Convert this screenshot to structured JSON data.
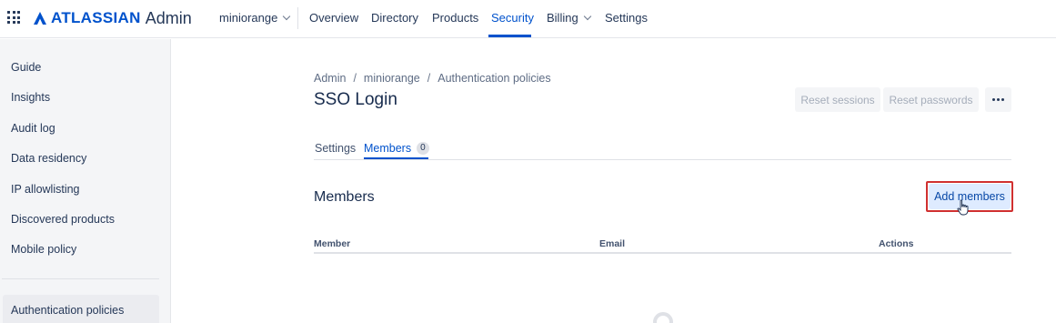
{
  "brand": {
    "name": "ATLASSIAN",
    "product": "Admin",
    "logo_icon": "atlassian-logo-icon",
    "accent": "#0052CC"
  },
  "org_selector": {
    "label": "miniorange",
    "icon": "chevron-down-icon"
  },
  "nav": {
    "items": [
      {
        "label": "Overview"
      },
      {
        "label": "Directory"
      },
      {
        "label": "Products"
      },
      {
        "label": "Security",
        "active": true
      },
      {
        "label": "Billing",
        "has_dropdown": true
      },
      {
        "label": "Settings"
      }
    ]
  },
  "sidebar": {
    "items": [
      {
        "label": "Guide"
      },
      {
        "label": "Insights"
      },
      {
        "label": "Audit log"
      },
      {
        "label": "Data residency"
      },
      {
        "label": "IP allowlisting"
      },
      {
        "label": "Discovered products"
      },
      {
        "label": "Mobile policy"
      },
      {
        "label": "Authentication policies",
        "active": true
      }
    ]
  },
  "breadcrumb": [
    "Admin",
    "miniorange",
    "Authentication policies"
  ],
  "page": {
    "title": "SSO Login"
  },
  "actions": {
    "reset_sessions": "Reset sessions",
    "reset_passwords": "Reset passwords",
    "more_icon": "more-icon"
  },
  "tabs": [
    {
      "label": "Settings"
    },
    {
      "label": "Members",
      "count": "0",
      "active": true
    }
  ],
  "members": {
    "section_title": "Members",
    "add_button": "Add members",
    "table_headers": [
      "Member",
      "Email",
      "Actions"
    ]
  },
  "colors": {
    "highlight": "#D03030",
    "primary": "#0052CC"
  }
}
